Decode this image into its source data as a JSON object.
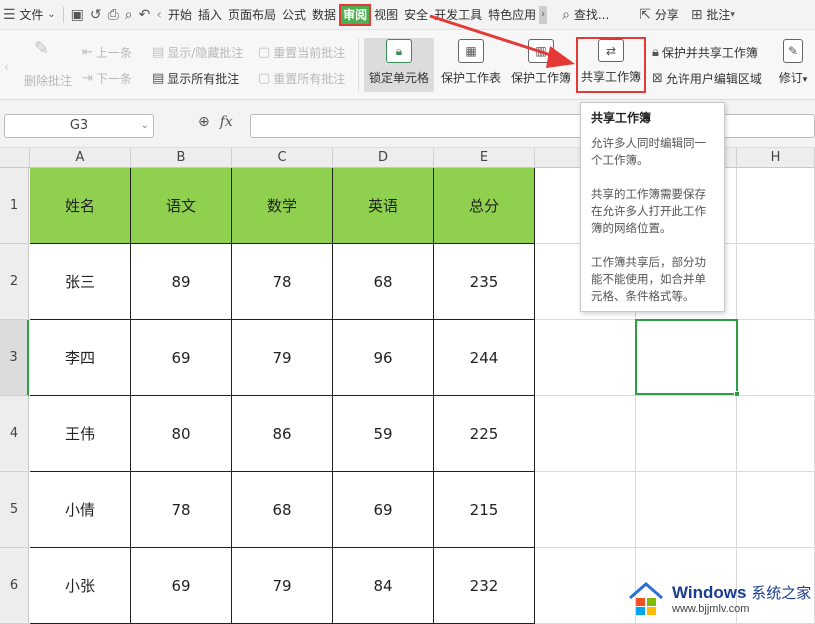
{
  "menubar": {
    "file_label": "文件",
    "tabs": [
      "开始",
      "插入",
      "页面布局",
      "公式",
      "数据",
      "审阅",
      "视图",
      "安全",
      "开发工具",
      "特色应用"
    ],
    "active_tab": "审阅",
    "search_label": "查找...",
    "share_label": "分享",
    "comment_label": "批注"
  },
  "ribbon": {
    "delete_comment": "删除批注",
    "prev": "上一条",
    "next": "下一条",
    "show_hide_comment": "显示/隐藏批注",
    "show_all_comments": "显示所有批注",
    "reset_current_comment": "重置当前批注",
    "reset_all_comments": "重置所有批注",
    "lock_cell": "锁定单元格",
    "protect_sheet": "保护工作表",
    "protect_workbook": "保护工作簿",
    "share_workbook": "共享工作簿",
    "protect_and_share": "保护并共享工作簿",
    "allow_edit_ranges": "允许用户编辑区域",
    "revise": "修订"
  },
  "formula": {
    "namebox": "G3",
    "fx": "fx"
  },
  "columns": [
    "A",
    "B",
    "C",
    "D",
    "E",
    "F",
    "G",
    "H"
  ],
  "rows": [
    "1",
    "2",
    "3",
    "4",
    "5",
    "6"
  ],
  "table": {
    "headers": [
      "姓名",
      "语文",
      "数学",
      "英语",
      "总分"
    ],
    "data": [
      [
        "张三",
        "89",
        "78",
        "68",
        "235"
      ],
      [
        "李四",
        "69",
        "79",
        "96",
        "244"
      ],
      [
        "王伟",
        "80",
        "86",
        "59",
        "225"
      ],
      [
        "小倩",
        "78",
        "68",
        "69",
        "215"
      ],
      [
        "小张",
        "69",
        "79",
        "84",
        "232"
      ]
    ]
  },
  "tooltip": {
    "title": "共享工作簿",
    "p1": "允许多人同时编辑同一个工作簿。",
    "p2": "共享的工作簿需要保存在允许多人打开此工作簿的网络位置。",
    "p3": "工作簿共享后，部分功能不能使用，如合并单元格、条件格式等。"
  },
  "watermark": {
    "brand": "Windows",
    "brand_cn": "系统之家",
    "url": "www.bjjmlv.com"
  },
  "colors": {
    "header_fill": "#8fd14f",
    "active_tab": "#4caf50",
    "highlight": "#e53935",
    "selection": "#2e9e44"
  }
}
